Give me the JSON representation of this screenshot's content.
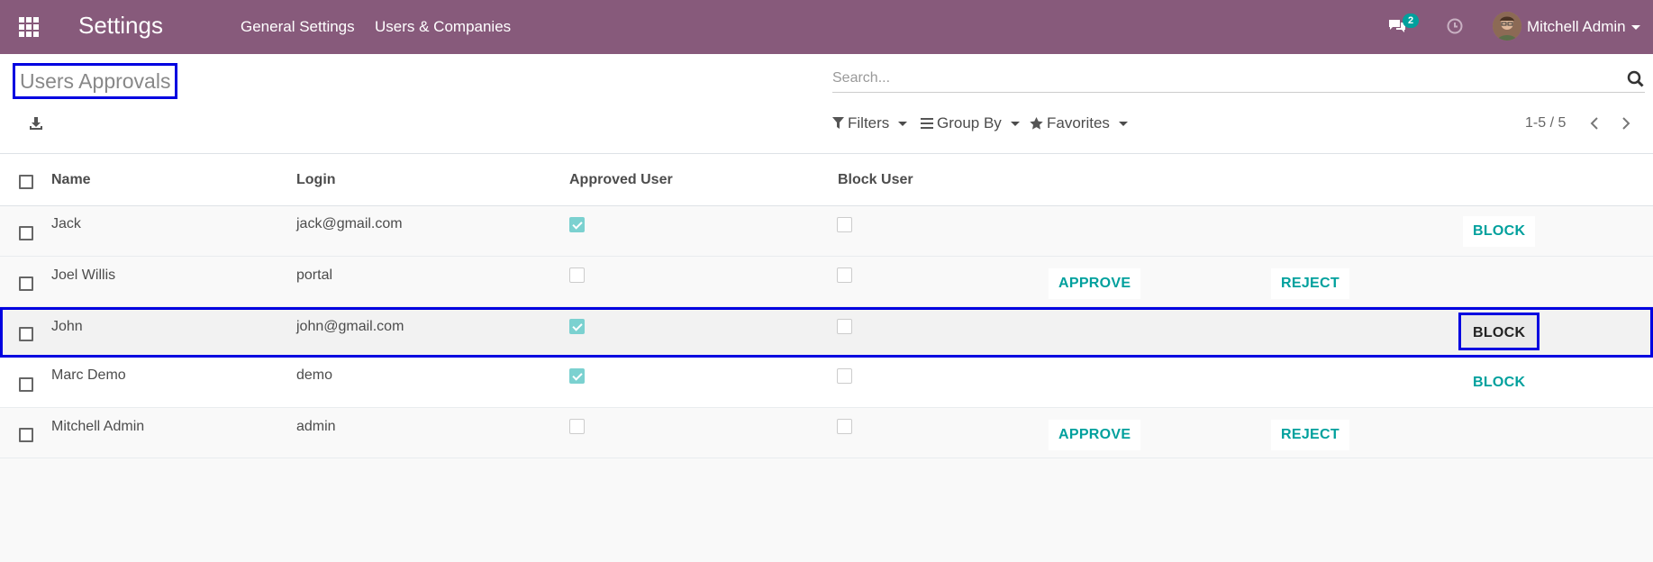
{
  "navbar": {
    "app_title": "Settings",
    "menu": [
      "General Settings",
      "Users & Companies"
    ],
    "chat_count": "2",
    "user_name": "Mitchell Admin",
    "bg_color": "#875a7b"
  },
  "control_panel": {
    "title": "Users Approvals",
    "search_placeholder": "Search...",
    "filters_label": "Filters",
    "group_by_label": "Group By",
    "favorites_label": "Favorites",
    "pager": "1-5 / 5"
  },
  "table": {
    "headers": {
      "name": "Name",
      "login": "Login",
      "approved": "Approved User",
      "block": "Block User"
    },
    "rows": [
      {
        "name": "Jack",
        "login": "jack@gmail.com",
        "approved": true,
        "blocked": false,
        "actions": [
          "BLOCK"
        ]
      },
      {
        "name": "Joel Willis",
        "login": "portal",
        "approved": false,
        "blocked": false,
        "actions": [
          "APPROVE",
          "REJECT"
        ]
      },
      {
        "name": "John",
        "login": "john@gmail.com",
        "approved": true,
        "blocked": false,
        "actions": [
          "BLOCK"
        ]
      },
      {
        "name": "Marc Demo",
        "login": "demo",
        "approved": true,
        "blocked": false,
        "actions": [
          "BLOCK"
        ]
      },
      {
        "name": "Mitchell Admin",
        "login": "admin",
        "approved": false,
        "blocked": false,
        "actions": [
          "APPROVE",
          "REJECT"
        ]
      }
    ]
  },
  "colors": {
    "accent": "#00a09d",
    "highlight": "#0000e0"
  }
}
